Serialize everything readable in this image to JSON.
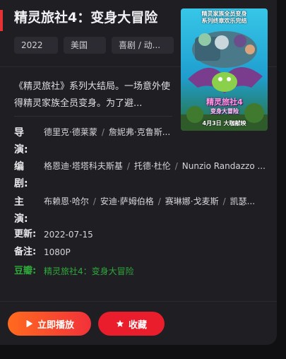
{
  "movie": {
    "title": "精灵旅社4：变身大冒险",
    "tags": [
      "2022",
      "美国",
      "喜剧 / 动..."
    ],
    "synopsis": "《精灵旅社》系列大结局。一场意外使得精灵家族全员变身。为了避..."
  },
  "poster": {
    "top_caption": "精灵家族全员变身",
    "top_caption2": "系列终章欢乐完结",
    "title_line1": "精灵旅社4",
    "title_line2": "变身大冒险",
    "bottom_caption": "4月3日 大咖献映"
  },
  "details": {
    "director": {
      "label1": "导",
      "label2": "演:",
      "names": [
        "德里克·德莱蒙",
        "詹妮弗·克鲁斯..."
      ]
    },
    "writer": {
      "label1": "编",
      "label2": "剧:",
      "names": [
        "格恩迪·塔塔科夫斯基",
        "托德·杜伦",
        "Nunzio Randazzo ..."
      ]
    },
    "cast": {
      "label1": "主",
      "label2": "演:",
      "names": [
        "布赖恩·哈尔",
        "安迪·萨姆伯格",
        "赛琳娜·戈麦斯",
        "凯瑟..."
      ]
    },
    "updated": {
      "label": "更新:",
      "value": "2022-07-15"
    },
    "note": {
      "label": "备注:",
      "value": "1080P"
    },
    "douban": {
      "label": "豆瓣:",
      "value": "精灵旅社4：变身大冒险"
    }
  },
  "actions": {
    "play_label": "立即播放",
    "favorite_label": "收藏"
  },
  "colors": {
    "accent_red": "#e63234",
    "play_gradient_start": "#ff6a1f",
    "play_gradient_end": "#f2313a",
    "favorite_bg": "#ea1d2c",
    "douban_green": "#2fa83b"
  }
}
